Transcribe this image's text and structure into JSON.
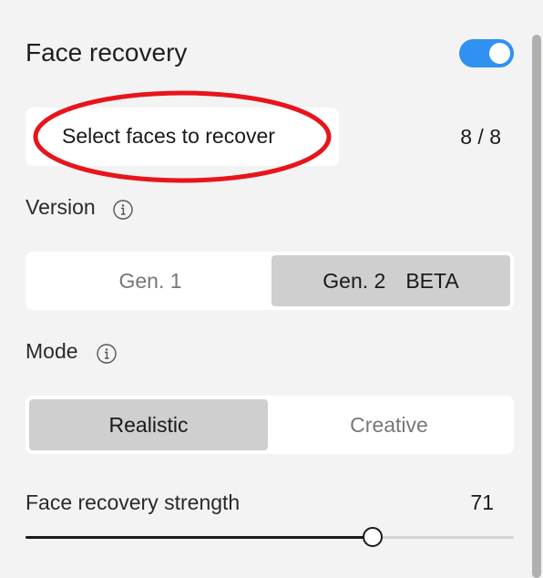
{
  "header": {
    "title": "Face recovery",
    "toggle_on": true
  },
  "select_faces": {
    "label": "Select faces to recover",
    "count": "8 / 8"
  },
  "version": {
    "label": "Version",
    "options": [
      {
        "label": "Gen. 1",
        "badge": "",
        "active": false
      },
      {
        "label": "Gen. 2",
        "badge": "BETA",
        "active": true
      }
    ]
  },
  "mode": {
    "label": "Mode",
    "options": [
      {
        "label": "Realistic",
        "active": true
      },
      {
        "label": "Creative",
        "active": false
      }
    ]
  },
  "strength": {
    "label": "Face recovery strength",
    "value": "71",
    "level": 0.71
  },
  "colors": {
    "toggle_accent": "#2f91f0",
    "highlight": "#e8141c",
    "active_segment": "#cfcfcf"
  },
  "icons": {
    "info": "info-icon"
  }
}
